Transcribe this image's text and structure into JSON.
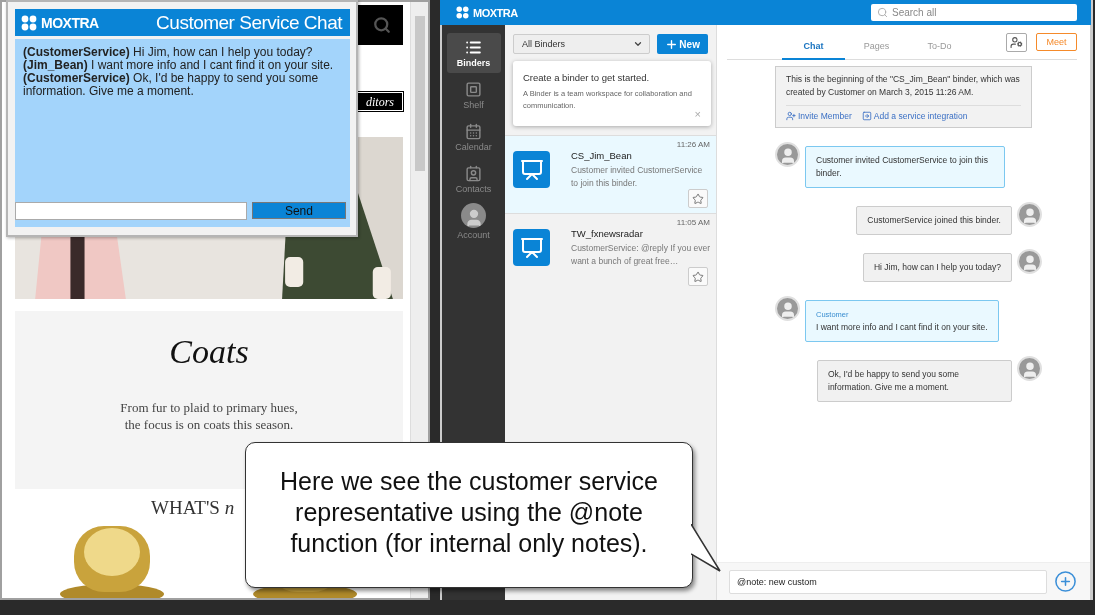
{
  "browser": {
    "tag": "ditors",
    "feature": {
      "title": "Coats",
      "lines": [
        "From fur to plaid to primary hues,",
        "the focus is on coats this season."
      ]
    },
    "heading": "WHAT'S *n*"
  },
  "chat_widget": {
    "logo": "MOXTRA",
    "title": "Customer Service Chat",
    "messages": [
      {
        "text": "**(CustomerService)** Hi Jim, how can I help you today?"
      },
      {
        "text": "**(Jim_Bean)** I want more info and I cant find it on your site."
      },
      {
        "text": "**(CustomerService)** Ok, I'd be happy to send you some information. Give me a moment."
      }
    ],
    "send_button": "Send"
  },
  "app": {
    "logo": "MOXTRA",
    "search": {
      "placeholder": "Search all"
    },
    "nav": [
      {
        "kind": "binders",
        "label": "Binders",
        "selected": true
      },
      {
        "kind": "shelf",
        "label": "Shelf",
        "selected": false
      },
      {
        "kind": "calendar",
        "label": "Calendar",
        "selected": false
      },
      {
        "kind": "contacts",
        "label": "Contacts",
        "selected": false
      },
      {
        "kind": "account",
        "label": "Account",
        "selected": false
      }
    ],
    "binder_filter": "All Binders",
    "new_button": "New",
    "tip": {
      "title": "Create a binder to get started.",
      "text": "A Binder is a team workspace for collaboration and communication.",
      "close": "×"
    },
    "binders": [
      {
        "name": "CS_Jim_Bean",
        "time": "11:26 AM",
        "preview": "Customer invited CustomerService to join this binder.",
        "selected": true
      },
      {
        "name": "TW_fxnewsradar",
        "time": "11:05 AM",
        "preview": "CustomerService: @reply If you ever want a bunch of great free…",
        "selected": false
      }
    ],
    "tabs": [
      {
        "label": "Chat",
        "selected": true
      },
      {
        "label": "Pages",
        "selected": false
      },
      {
        "label": "To-Do",
        "selected": false
      }
    ],
    "meet_button": "Meet",
    "intro": {
      "text": "This is the beginning of the \"CS_Jim_Bean\" binder, which was created by Customer on March 3, 2015 11:26 AM.",
      "links": [
        "Invite Member",
        "Add a service integration"
      ]
    },
    "messages": [
      {
        "kind": "incoming",
        "text": "Customer invited CustomerService to join this binder."
      },
      {
        "kind": "outgoing",
        "text": "CustomerService joined this binder."
      },
      {
        "kind": "outgoing",
        "text": "Hi Jim, how can I help you today?"
      },
      {
        "kind": "incoming",
        "sender": "Customer",
        "text": "I want more info and I cant find it on your site."
      },
      {
        "kind": "outgoing",
        "text": "Ok, I'd be happy to send you some information. Give me a moment."
      }
    ],
    "composer": {
      "value": "@note: new custom"
    }
  },
  "callout": {
    "text": "Here we see the customer service representative using the @note function (for internal only notes)."
  }
}
